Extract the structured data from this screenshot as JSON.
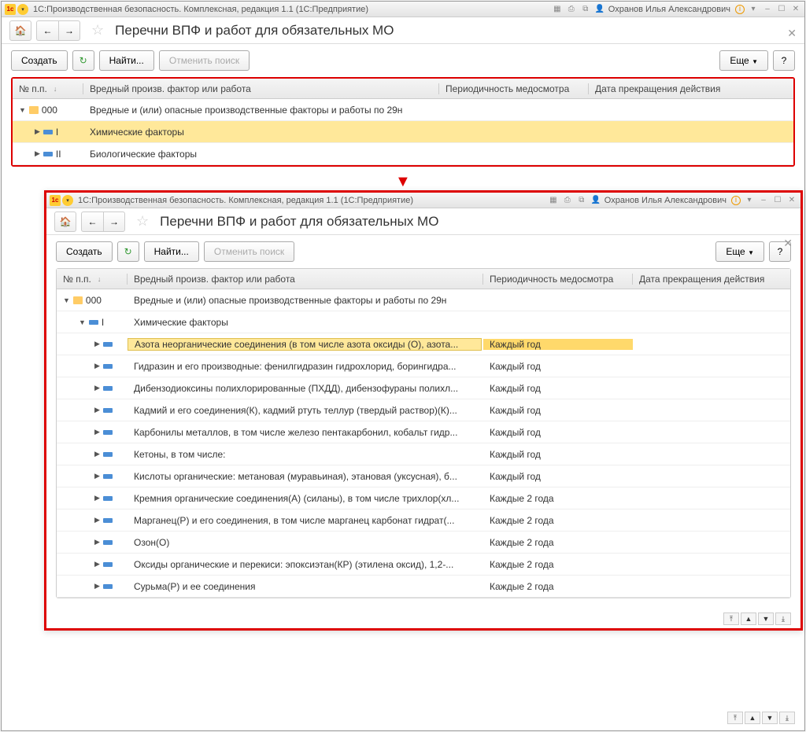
{
  "app": {
    "title": "1С:Производственная безопасность. Комплексная, редакция 1.1  (1С:Предприятие)",
    "user": "Охранов Илья Александрович"
  },
  "page": {
    "title": "Перечни ВПФ и работ для обязательных МО"
  },
  "toolbar": {
    "create": "Создать",
    "find": "Найти...",
    "cancel_search": "Отменить поиск",
    "more": "Еще"
  },
  "columns": {
    "num": "№ п.п.",
    "factor": "Вредный произв. фактор или работа",
    "period": "Периодичность медосмотра",
    "end_date": "Дата прекращения действия"
  },
  "main_rows": [
    {
      "num": "000",
      "name": "Вредные и (или) опасные производственные факторы и работы по 29н",
      "period": "",
      "level": 0,
      "expanded": true,
      "icon": "folder"
    },
    {
      "num": "I",
      "name": "Химические факторы",
      "period": "",
      "level": 1,
      "expanded": false,
      "icon": "item",
      "selected": true
    },
    {
      "num": "II",
      "name": "Биологические факторы",
      "period": "",
      "level": 1,
      "expanded": false,
      "icon": "item"
    }
  ],
  "nested_rows": [
    {
      "num": "000",
      "name": "Вредные и (или) опасные производственные факторы и работы по 29н",
      "period": "",
      "level": 0,
      "expanded": true,
      "icon": "folder"
    },
    {
      "num": "I",
      "name": "Химические факторы",
      "period": "",
      "level": 1,
      "expanded": true,
      "icon": "item"
    },
    {
      "num": "",
      "name": "Азота неорганические соединения (в том числе азота оксиды (О), азота...",
      "period": "Каждый год",
      "level": 2,
      "icon": "item",
      "selected": true
    },
    {
      "num": "",
      "name": "Гидразин и его производные: фенилгидразин гидрохлорид, борингидра...",
      "period": "Каждый год",
      "level": 2,
      "icon": "item"
    },
    {
      "num": "",
      "name": "Дибензодиоксины полихлорированные (ПХДД), дибензофураны полихл...",
      "period": "Каждый год",
      "level": 2,
      "icon": "item"
    },
    {
      "num": "",
      "name": "Кадмий и его соединения(К), кадмий ртуть теллур (твердый раствор)(К)...",
      "period": "Каждый год",
      "level": 2,
      "icon": "item"
    },
    {
      "num": "",
      "name": "Карбонилы металлов, в том числе железо пентакарбонил, кобальт гидр...",
      "period": "Каждый год",
      "level": 2,
      "icon": "item"
    },
    {
      "num": "",
      "name": "Кетоны, в том числе:",
      "period": "Каждый год",
      "level": 2,
      "icon": "item"
    },
    {
      "num": "",
      "name": "Кислоты органические: метановая (муравьиная), этановая (уксусная), б...",
      "period": "Каждый год",
      "level": 2,
      "icon": "item"
    },
    {
      "num": "",
      "name": "Кремния органические соединения(А) (силаны), в том числе трихлор(хл...",
      "period": "Каждые 2 года",
      "level": 2,
      "icon": "item"
    },
    {
      "num": "",
      "name": "Марганец(Р) и его соединения, в том числе марганец карбонат гидрат(...",
      "period": "Каждые 2 года",
      "level": 2,
      "icon": "item"
    },
    {
      "num": "",
      "name": "Озон(О)",
      "period": "Каждые 2 года",
      "level": 2,
      "icon": "item"
    },
    {
      "num": "",
      "name": "Оксиды органические и перекиси: эпоксиэтан(КР) (этилена оксид), 1,2-...",
      "period": "Каждые 2 года",
      "level": 2,
      "icon": "item"
    },
    {
      "num": "",
      "name": "Сурьма(Р) и ее соединения",
      "period": "Каждые 2 года",
      "level": 2,
      "icon": "item"
    }
  ]
}
